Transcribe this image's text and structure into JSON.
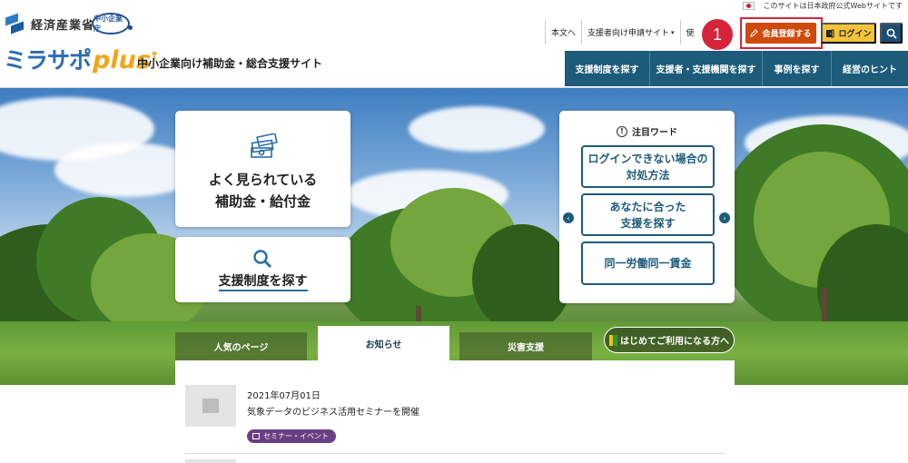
{
  "header": {
    "ministry": "経済産業省",
    "agency": "中小企業庁",
    "logo_ja": "ミラサポ",
    "logo_plus": "plus",
    "tagline": "中小企業向け補助金・総合支援サイト",
    "gov_notice": "このサイトは日本政府公式Webサイトです",
    "util_links": [
      {
        "label": "本文へ"
      },
      {
        "label": "支援者向け申請サイト",
        "dropdown": "▾"
      },
      {
        "label": "使"
      }
    ],
    "member_button": "会員登録する",
    "login_button": "ログイン",
    "step_number": "1",
    "nav": [
      {
        "label": "支援制度を探す"
      },
      {
        "label": "支援者・支援機関を探す"
      },
      {
        "label": "事例を探す"
      },
      {
        "label": "経営のヒント"
      }
    ]
  },
  "hero": {
    "popular": {
      "line1": "よく見られている",
      "line2": "補助金・給付金"
    },
    "search": {
      "label": "支援制度を探す"
    },
    "words": {
      "heading": "注目ワード",
      "items": [
        {
          "line1": "ログインできない場合の",
          "line2": "対処方法"
        },
        {
          "line1": "あなたに合った",
          "line2": "支援を探す"
        },
        {
          "line1": "同一労働同一賃金",
          "line2": ""
        }
      ],
      "prev": "‹",
      "next": "›"
    }
  },
  "tabs": {
    "items": [
      {
        "label": "人気のページ"
      },
      {
        "label": "お知らせ"
      },
      {
        "label": "災害支援"
      }
    ],
    "active_index": 1,
    "first_time": "はじめてご利用になる方へ"
  },
  "news": {
    "items": [
      {
        "date": "2021年07月01日",
        "title": "気象データのビジネス活用セミナーを開催",
        "tag": "セミナー・イベント"
      }
    ]
  },
  "colors": {
    "nav_bg": "#1c5b7a",
    "member_button": "#cf4a0b",
    "login_button": "#f3c43a",
    "highlight": "#d6243a",
    "tag_bg": "#6a3e82"
  }
}
